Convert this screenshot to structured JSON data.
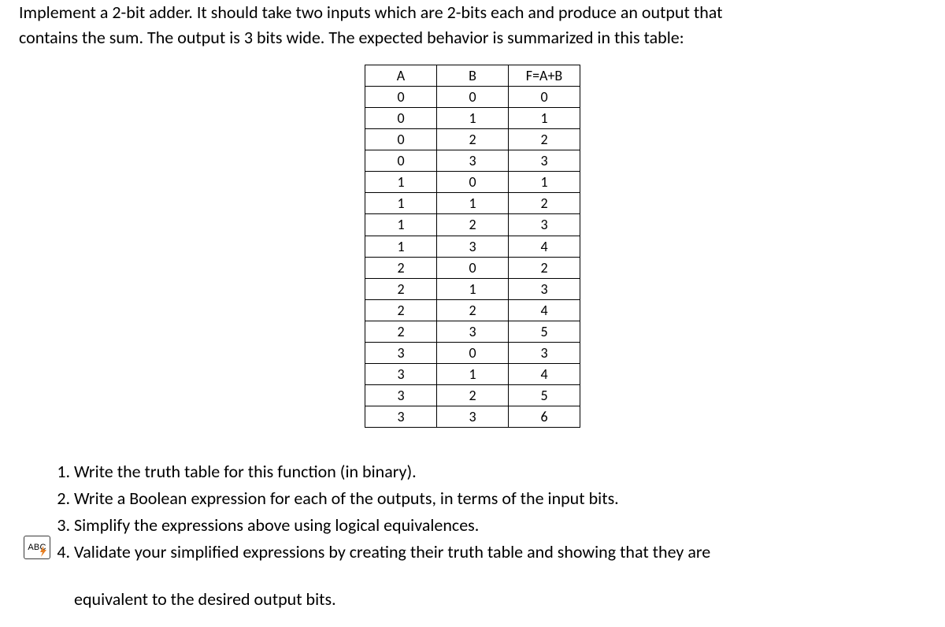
{
  "intro": {
    "line1": "Implement a 2-bit adder.  It should take two inputs which are 2-bits each and produce an output that",
    "line2": "contains the sum.  The output is 3 bits wide.  The expected behavior is summarized in this table:"
  },
  "table": {
    "headers": [
      "A",
      "B",
      "F=A+B"
    ],
    "rows": [
      [
        "0",
        "0",
        "0"
      ],
      [
        "0",
        "1",
        "1"
      ],
      [
        "0",
        "2",
        "2"
      ],
      [
        "0",
        "3",
        "3"
      ],
      [
        "1",
        "0",
        "1"
      ],
      [
        "1",
        "1",
        "2"
      ],
      [
        "1",
        "2",
        "3"
      ],
      [
        "1",
        "3",
        "4"
      ],
      [
        "2",
        "0",
        "2"
      ],
      [
        "2",
        "1",
        "3"
      ],
      [
        "2",
        "2",
        "4"
      ],
      [
        "2",
        "3",
        "5"
      ],
      [
        "3",
        "0",
        "3"
      ],
      [
        "3",
        "1",
        "4"
      ],
      [
        "3",
        "2",
        "5"
      ],
      [
        "3",
        "3",
        "6"
      ]
    ]
  },
  "questions": [
    "Write the truth table for this function (in binary).",
    "Write a Boolean expression for each of the outputs, in terms of the input bits.",
    "Simplify the expressions above using logical equivalences.",
    "Validate your simplified expressions by creating their truth table and showing that they are"
  ],
  "trailing": "equivalent to the desired output bits.",
  "badge_label": "ABC"
}
